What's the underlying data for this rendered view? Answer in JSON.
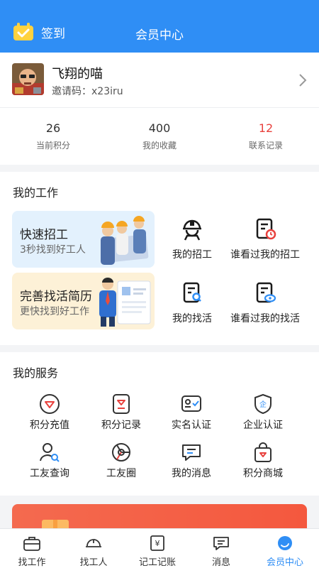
{
  "header": {
    "checkin_label": "签到",
    "title": "会员中心"
  },
  "profile": {
    "name": "飞翔的喵",
    "invite": "邀请码：x23iru"
  },
  "stats": [
    {
      "value": "26",
      "label": "当前积分"
    },
    {
      "value": "400",
      "label": "我的收藏"
    },
    {
      "value": "12",
      "label": "联系记录"
    }
  ],
  "work": {
    "title": "我的工作",
    "promo_hire": {
      "title": "快速招工",
      "subtitle": "3秒找到好工人"
    },
    "promo_resume": {
      "title": "完善找活简历",
      "subtitle": "更快找到好工作"
    },
    "tiles": [
      "我的招工",
      "谁看过我的招工",
      "我的找活",
      "谁看过我的找活"
    ]
  },
  "services": {
    "title": "我的服务",
    "items": [
      {
        "label": "积分充值",
        "icon": "diamond-icon"
      },
      {
        "label": "积分记录",
        "icon": "points-record-icon"
      },
      {
        "label": "实名认证",
        "icon": "id-card-icon"
      },
      {
        "label": "企业认证",
        "icon": "enterprise-shield-icon"
      },
      {
        "label": "工友查询",
        "icon": "user-search-icon"
      },
      {
        "label": "工友圈",
        "icon": "aperture-icon"
      },
      {
        "label": "我的消息",
        "icon": "message-icon"
      },
      {
        "label": "积分商城",
        "icon": "shopping-bag-icon"
      }
    ]
  },
  "tabbar": {
    "items": [
      {
        "label": "找工作",
        "icon": "briefcase-icon"
      },
      {
        "label": "找工人",
        "icon": "helmet-icon"
      },
      {
        "label": "记工记账",
        "icon": "yen-ledger-icon"
      },
      {
        "label": "消息",
        "icon": "message-icon"
      },
      {
        "label": "会员中心",
        "icon": "member-icon"
      }
    ],
    "active_index": 4
  },
  "colors": {
    "accent": "#2f8ef5",
    "highlight_red": "#e8413d",
    "banner": "#f4583e"
  }
}
